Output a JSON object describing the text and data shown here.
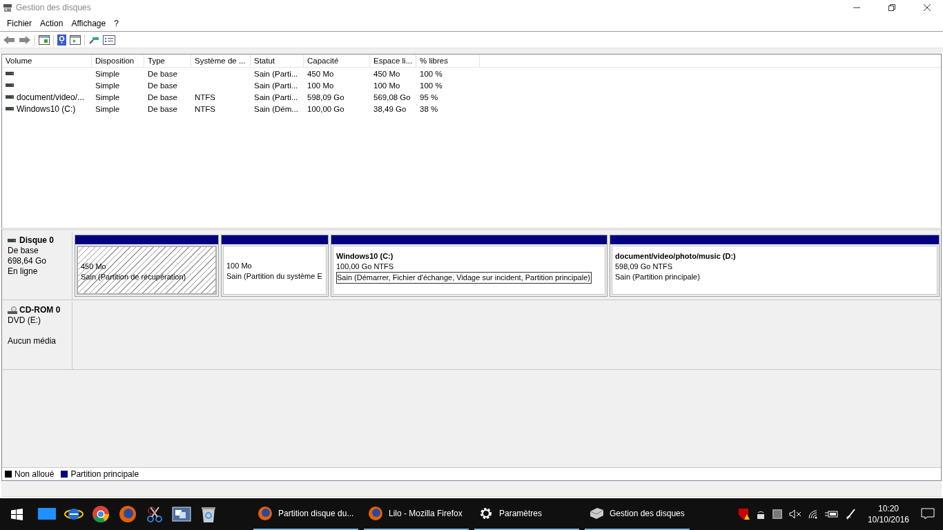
{
  "window": {
    "title": "Gestion des disques"
  },
  "menu": [
    "Fichier",
    "Action",
    "Affichage",
    "?"
  ],
  "table": {
    "columns": [
      "Volume",
      "Disposition",
      "Type",
      "Système de ...",
      "Statut",
      "Capacité",
      "Espace li...",
      "% libres"
    ],
    "rows": [
      {
        "cells": [
          "",
          "Simple",
          "De base",
          "",
          "Sain (Parti...",
          "450 Mo",
          "450 Mo",
          "100 %"
        ]
      },
      {
        "cells": [
          "",
          "Simple",
          "De base",
          "",
          "Sain (Parti...",
          "100 Mo",
          "100 Mo",
          "100 %"
        ]
      },
      {
        "cells": [
          "document/video/...",
          "Simple",
          "De base",
          "NTFS",
          "Sain (Parti...",
          "598,09 Go",
          "569,08 Go",
          "95 %"
        ]
      },
      {
        "cells": [
          "Windows10 (C:)",
          "Simple",
          "De base",
          "NTFS",
          "Sain (Dém...",
          "100,00 Go",
          "38,49 Go",
          "38 %"
        ]
      }
    ]
  },
  "disks": [
    {
      "kind": "disk",
      "name": "Disque 0",
      "lines": [
        "De base",
        "698,64 Go",
        "En ligne"
      ],
      "partitions": [
        {
          "kind": "recovery",
          "size": "450 Mo",
          "status": "Sain (Partition de récupération)",
          "focused": false
        },
        {
          "kind": "primary",
          "size": "100 Mo",
          "status": "Sain (Partition du système E",
          "focused": false
        },
        {
          "kind": "primary",
          "title": "Windows10  (C:)",
          "size": "100,00 Go NTFS",
          "status": "Sain (Démarrer, Fichier d'échange, Vidage sur incident, Partition principale)",
          "focused": true
        },
        {
          "kind": "primary",
          "title": "document/video/photo/music  (D:)",
          "size": "598,09 Go NTFS",
          "status": "Sain (Partition principale)",
          "focused": false
        }
      ]
    },
    {
      "kind": "cdrom",
      "name": "CD-ROM 0",
      "lines": [
        "DVD (E:)"
      ],
      "media": "Aucun média"
    }
  ],
  "legend": [
    {
      "label": "Non alloué",
      "color": "#000000"
    },
    {
      "label": "Partition principale",
      "color": "#000080"
    }
  ],
  "taskbar": {
    "tasks": [
      {
        "kind": "firefox",
        "label": "Partition disque du..."
      },
      {
        "kind": "firefox",
        "label": "Lilo - Mozilla Firefox"
      },
      {
        "kind": "settings",
        "label": "Paramètres"
      },
      {
        "kind": "disk",
        "label": "Gestion des disques"
      }
    ],
    "time": "10:20",
    "date": "10/10/2016"
  }
}
